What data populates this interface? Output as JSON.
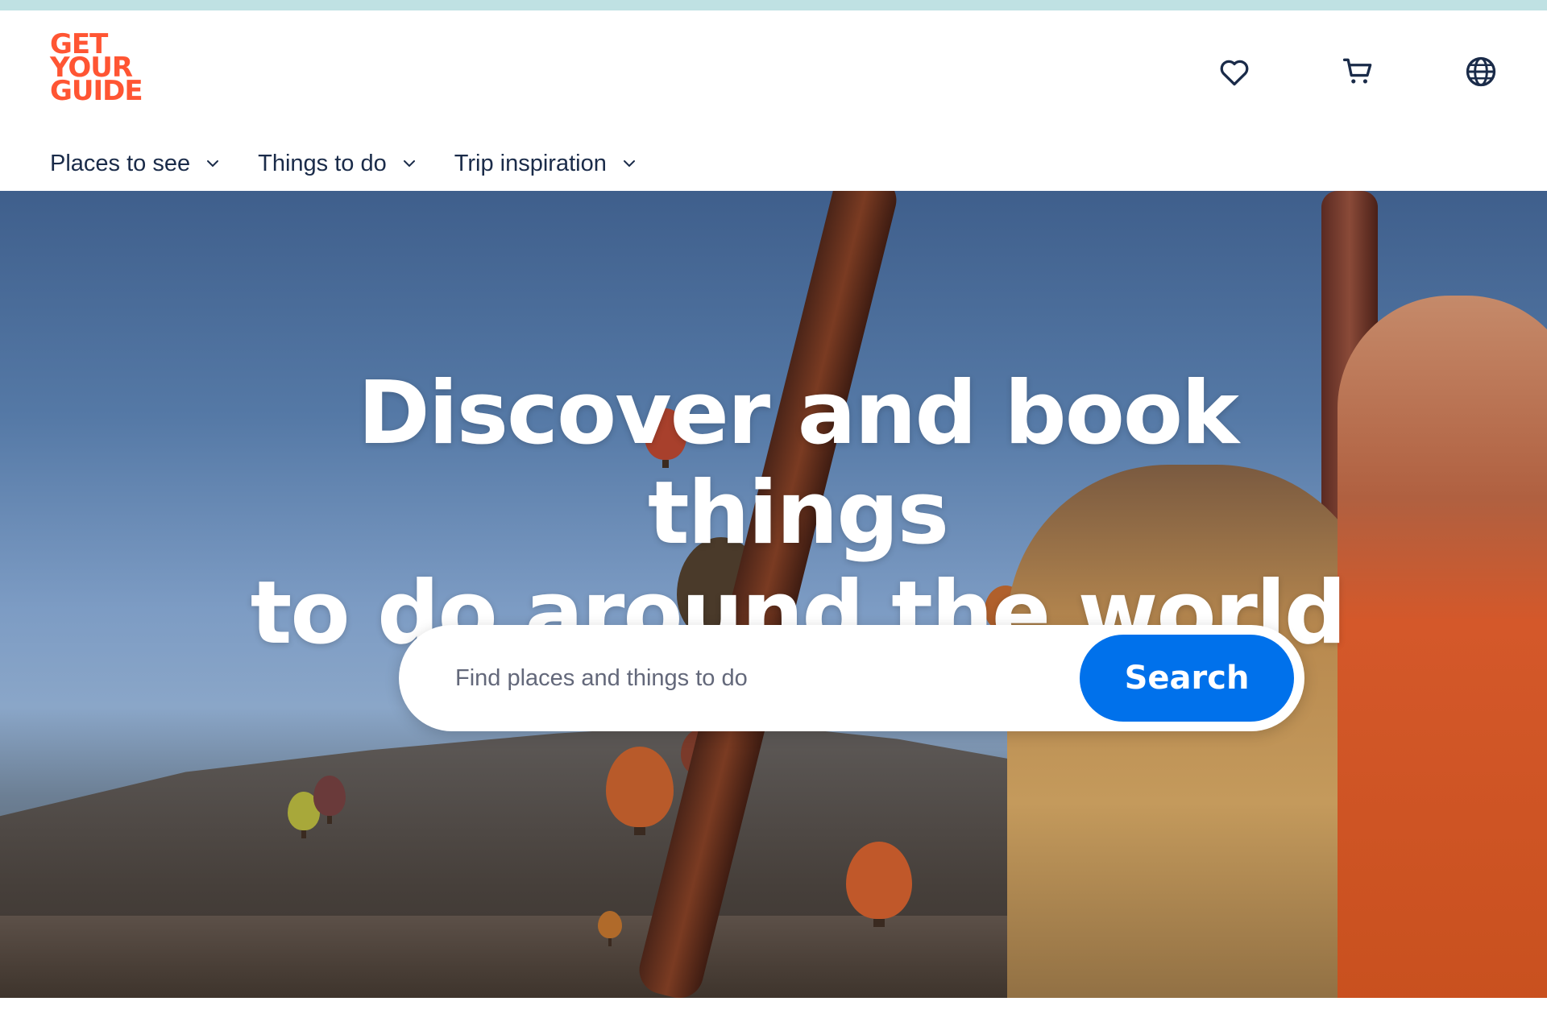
{
  "brand": {
    "logo_lines": [
      "GET",
      "YOUR",
      "GUIDE"
    ],
    "color": "#ff5533"
  },
  "header": {
    "icons": [
      "heart-icon",
      "cart-icon",
      "globe-icon"
    ]
  },
  "nav": {
    "items": [
      {
        "label": "Places to see"
      },
      {
        "label": "Things to do"
      },
      {
        "label": "Trip inspiration"
      }
    ]
  },
  "hero": {
    "headline_line1": "Discover and book things",
    "headline_line2": "to do around the world"
  },
  "search": {
    "placeholder": "Find places and things to do",
    "value": "",
    "button_label": "Search",
    "button_color": "#0071eb"
  }
}
